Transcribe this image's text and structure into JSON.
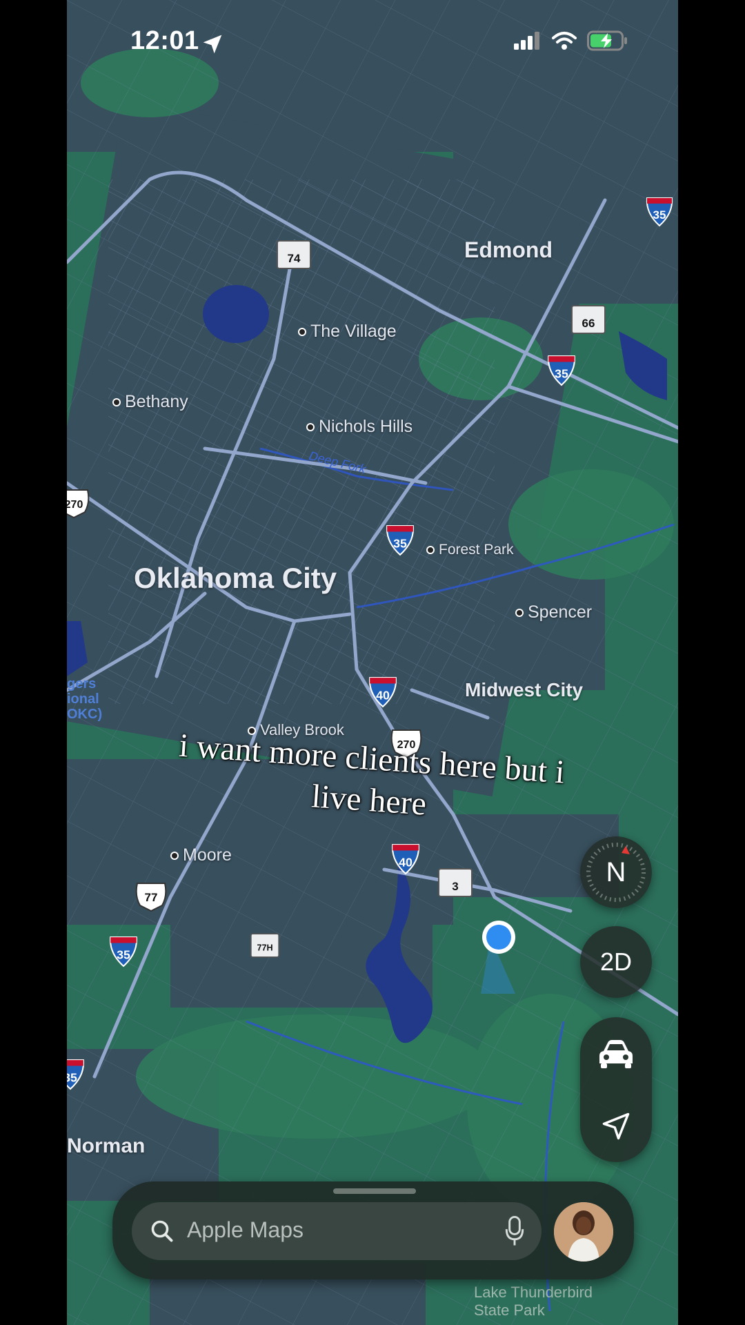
{
  "status_bar": {
    "time": "12:01",
    "location_arrow_icon": "location-arrow-icon",
    "signal_icon": "cellular-signal-icon",
    "wifi_icon": "wifi-icon",
    "battery_icon": "battery-charging-icon"
  },
  "map": {
    "cities": {
      "edmond": "Edmond",
      "okc": "Oklahoma City",
      "norman": "Norman",
      "midwest_city": "Midwest City"
    },
    "towns": {
      "the_village": "The Village",
      "bethany": "Bethany",
      "nichols_hills": "Nichols Hills",
      "forest_park": "Forest Park",
      "spencer": "Spencer",
      "valley_brook": "Valley Brook",
      "moore": "Moore"
    },
    "river_label": "Deep Fork",
    "partial_label": [
      "gers",
      "ional",
      "OKC)"
    ],
    "lake_label": [
      "Lake Thunderbird",
      "State Park"
    ],
    "shields": {
      "i35": "35",
      "i40": "40",
      "us77": "77",
      "us270": "270",
      "ok74": "74",
      "ok66": "66",
      "ok3": "3",
      "ok77h": "77H",
      "i35_partial": "35",
      "us270_partial": "270"
    }
  },
  "caption": {
    "line1": "i want more clients here but i",
    "line2": "live here"
  },
  "controls": {
    "compass_label": "N",
    "view_mode_label": "2D",
    "car_icon": "car-icon",
    "track_icon": "location-arrow-icon"
  },
  "search": {
    "placeholder": "Apple Maps",
    "search_icon": "search-icon",
    "mic_icon": "microphone-icon"
  },
  "colors": {
    "map_green": "#2b6e5a",
    "urban_gray": "#3a4858",
    "road": "#8fa3c6",
    "water": "#22398a",
    "interstate_blue": "#1f5fb8",
    "interstate_red": "#c8102e",
    "user_location": "#2f8cf0"
  }
}
